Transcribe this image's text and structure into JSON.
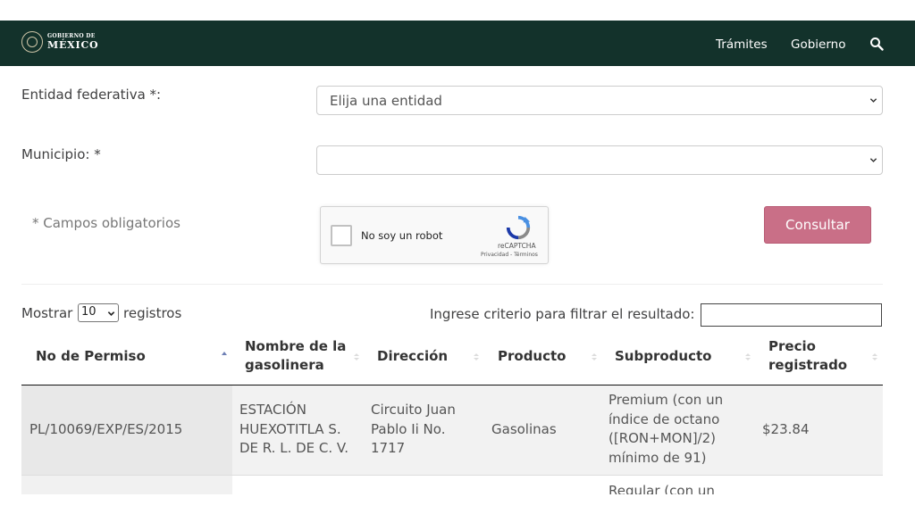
{
  "header": {
    "logo_small": "GOBIERNO DE",
    "logo_big": "MÉXICO",
    "nav": [
      "Trámites",
      "Gobierno"
    ],
    "bg_color": "#13322b"
  },
  "form": {
    "entidad_label": "Entidad federativa *:",
    "entidad_value": "Elija una entidad",
    "municipio_label": "Municipio: *",
    "municipio_value": "",
    "required_note": "* Campos obligatorios",
    "captcha_text": "No soy un robot",
    "captcha_brand": "reCAPTCHA",
    "captcha_links": "Privacidad - Términos",
    "submit_label": "Consultar",
    "submit_color": "#c96f87"
  },
  "table_controls": {
    "show_prefix": "Mostrar",
    "show_value": "10",
    "show_suffix": "registros",
    "filter_label": "Ingrese criterio para filtrar el resultado:",
    "filter_value": ""
  },
  "table": {
    "headers": [
      "No de Permiso",
      "Nombre de la gasolinera",
      "Dirección",
      "Producto",
      "Subproducto",
      "Precio registrado"
    ],
    "rows": [
      {
        "permiso": "PL/10069/EXP/ES/2015",
        "nombre": "ESTACIÓN HUEXOTITLA S. DE R. L. DE C. V.",
        "direccion": "Circuito Juan Pablo Ii No. 1717",
        "producto": "Gasolinas",
        "subproducto": "Premium (con un índice de octano ([RON+MON]/2) mínimo de 91)",
        "precio": "$23.84"
      },
      {
        "permiso": "",
        "nombre": "",
        "direccion": "",
        "producto": "",
        "subproducto": "Regular (con un",
        "precio": ""
      }
    ]
  }
}
